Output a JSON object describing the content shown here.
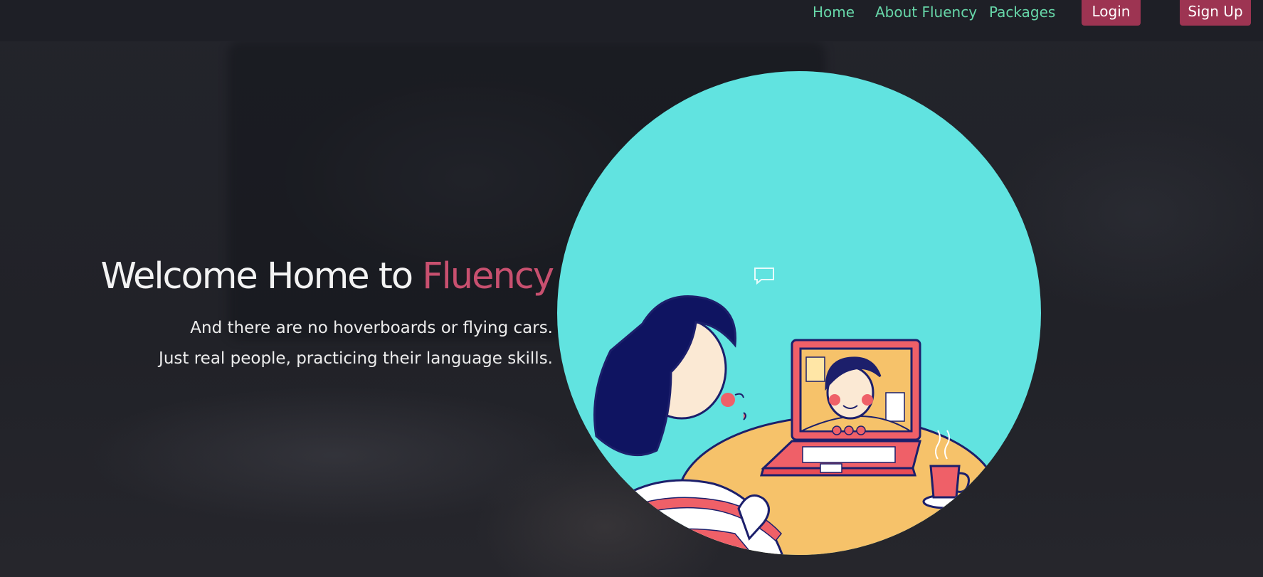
{
  "nav": {
    "links": [
      {
        "label": "Home"
      },
      {
        "label": "About Fluency"
      },
      {
        "label": "Packages"
      }
    ],
    "login_label": "Login",
    "signup_label": "Sign Up"
  },
  "hero": {
    "title_prefix": "Welcome Home to ",
    "title_accent": "Fluency",
    "line1": "And there are no hoverboards or flying cars.",
    "line2": "Just real people, practicing their language skills."
  },
  "colors": {
    "background": "#1d1e24",
    "nav_link": "#67d7a9",
    "button": "#9d3452",
    "accent_text": "#c8506f",
    "illustration_bg": "#61e3e0"
  },
  "icons": {
    "illustration_bubble": "chat-bubble-icon"
  }
}
